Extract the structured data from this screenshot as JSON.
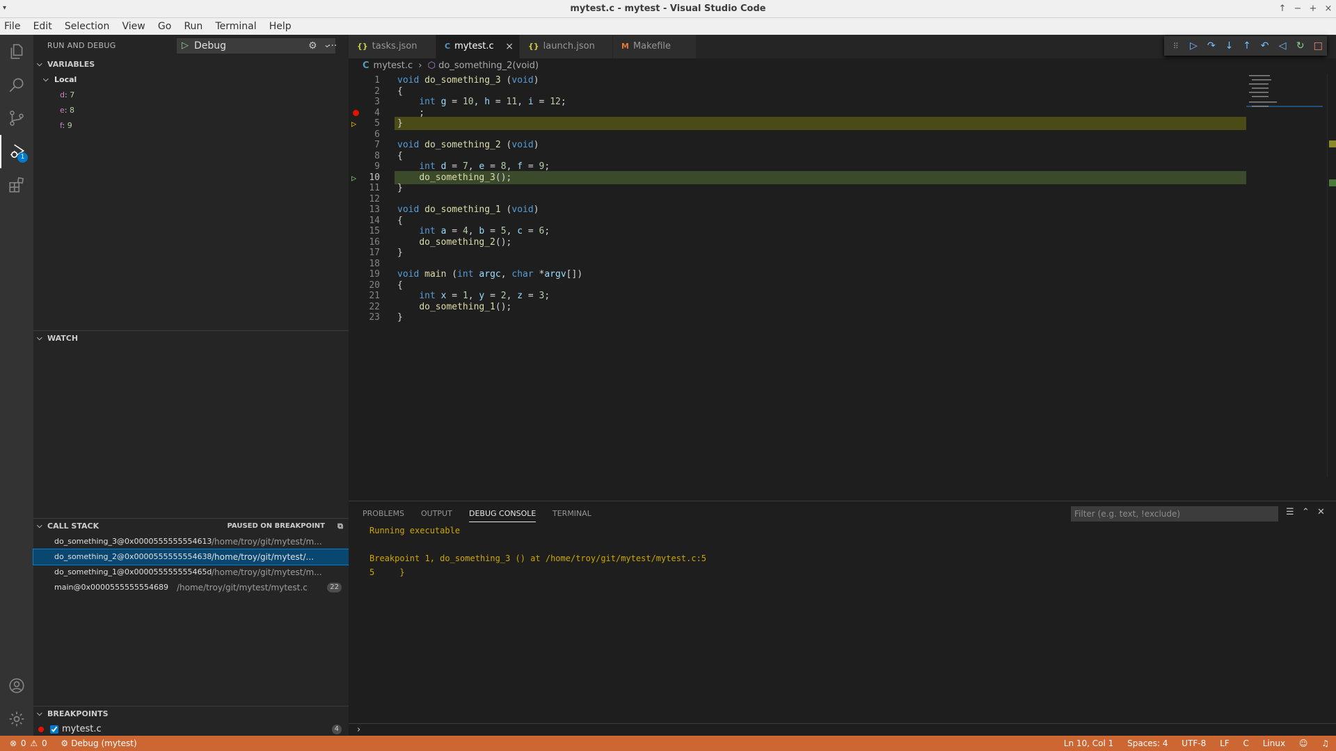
{
  "window": {
    "title": "mytest.c - mytest - Visual Studio Code"
  },
  "menu": [
    "File",
    "Edit",
    "Selection",
    "View",
    "Go",
    "Run",
    "Terminal",
    "Help"
  ],
  "activity": {
    "debug_badge": "1"
  },
  "sidebar": {
    "title": "RUN AND DEBUG",
    "config": "Debug",
    "variables": {
      "header": "VARIABLES",
      "scope": "Local",
      "items": [
        {
          "name": "d",
          "value": "7"
        },
        {
          "name": "e",
          "value": "8"
        },
        {
          "name": "f",
          "value": "9"
        }
      ]
    },
    "watch": {
      "header": "WATCH"
    },
    "callstack": {
      "header": "CALL STACK",
      "status": "PAUSED ON BREAKPOINT",
      "frames": [
        {
          "fn": "do_something_3@0x0000555555554613",
          "path": "/home/troy/git/mytest/m..."
        },
        {
          "fn": "do_something_2@0x0000555555554638",
          "path": "/home/troy/git/mytest/..."
        },
        {
          "fn": "do_something_1@0x000055555555465d",
          "path": "/home/troy/git/mytest/m..."
        },
        {
          "fn": "main@0x0000555555554689",
          "path": "/home/troy/git/mytest/mytest.c",
          "line": "22"
        }
      ]
    },
    "breakpoints": {
      "header": "BREAKPOINTS",
      "items": [
        {
          "file": "mytest.c",
          "count": "4",
          "checked": true
        }
      ]
    }
  },
  "tabs": [
    {
      "icon": "{}",
      "label": "tasks.json"
    },
    {
      "icon": "C",
      "label": "mytest.c",
      "close": "×"
    },
    {
      "icon": "{}",
      "label": "launch.json"
    },
    {
      "icon": "M",
      "label": "Makefile"
    }
  ],
  "breadcrumb": {
    "file": "mytest.c",
    "symbol": "do_something_2(void)"
  },
  "code_lines": [
    "void do_something_3 (void)",
    "{",
    "    int g = 10, h = 11, i = 12;",
    "    ;",
    "}",
    "",
    "void do_something_2 (void)",
    "{",
    "    int d = 7, e = 8, f = 9;",
    "    do_something_3();",
    "}",
    "",
    "void do_something_1 (void)",
    "{",
    "    int a = 4, b = 5, c = 6;",
    "    do_something_2();",
    "}",
    "",
    "void main (int argc, char *argv[])",
    "{",
    "    int x = 1, y = 2, z = 3;",
    "    do_something_1();",
    "}"
  ],
  "editor_state": {
    "breakpoint_line": 4,
    "top_frame_line": 5,
    "focused_frame_line": 10
  },
  "panel": {
    "tabs": [
      "PROBLEMS",
      "OUTPUT",
      "DEBUG CONSOLE",
      "TERMINAL"
    ],
    "active_tab": "DEBUG CONSOLE",
    "filter_placeholder": "Filter (e.g. text, !exclude)",
    "console": [
      "Running executable",
      "",
      "Breakpoint 1, do_something_3 () at /home/troy/git/mytest/mytest.c:5",
      "5\t}"
    ]
  },
  "status": {
    "errors": "0",
    "warnings": "0",
    "debug_session": "Debug (mytest)",
    "position": "Ln 10, Col 1",
    "spaces": "Spaces: 4",
    "encoding": "UTF-8",
    "eol": "LF",
    "language": "C",
    "platform": "Linux"
  },
  "colors": {
    "statusbar": "#cc6633",
    "accent": "#007acc",
    "breakpoint": "#e51400",
    "current_line": "#4b4b18"
  }
}
